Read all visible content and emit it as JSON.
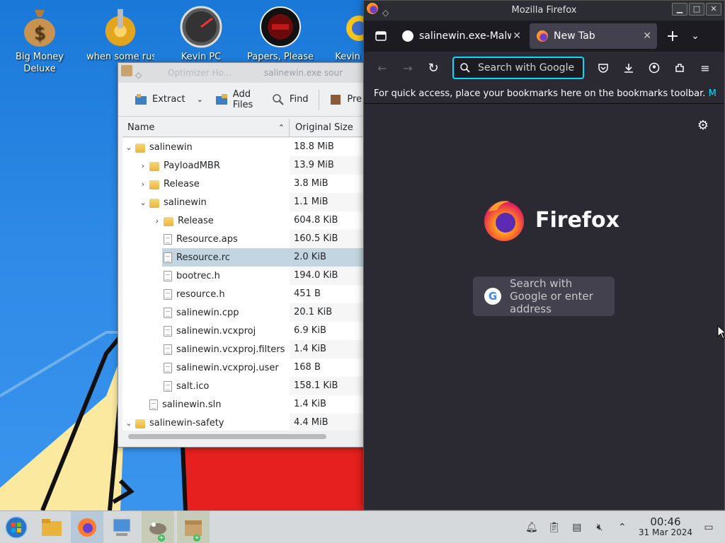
{
  "desktop": {
    "icons": [
      {
        "label": "Big Money Deluxe",
        "icon": "money-bag-icon"
      },
      {
        "label": "when some russian ha",
        "icon": "gear-icon"
      },
      {
        "label": "Kevin PC",
        "icon": "speedometer-icon"
      },
      {
        "label": "Papers, Please",
        "icon": "papers-please-icon"
      },
      {
        "label": "Kevin",
        "icon": "sun-icon"
      }
    ]
  },
  "ark": {
    "title": "salinewin.exe sour",
    "title_ghost": "Optimizer Ho...",
    "toolbar": {
      "extract": "Extract",
      "add_files": "Add Files",
      "find": "Find",
      "preview": "Pre"
    },
    "columns": {
      "name": "Name",
      "size": "Original Size"
    },
    "rows": [
      {
        "name": "salinewin",
        "size": "18.8 MiB",
        "type": "folder",
        "level": 0,
        "expand": "open"
      },
      {
        "name": "PayloadMBR",
        "size": "13.9 MiB",
        "type": "folder",
        "level": 1,
        "expand": "closed"
      },
      {
        "name": "Release",
        "size": "3.8 MiB",
        "type": "folder",
        "level": 1,
        "expand": "closed"
      },
      {
        "name": "salinewin",
        "size": "1.1 MiB",
        "type": "folder",
        "level": 1,
        "expand": "open"
      },
      {
        "name": "Release",
        "size": "604.8 KiB",
        "type": "folder",
        "level": 2,
        "expand": "closed"
      },
      {
        "name": "Resource.aps",
        "size": "160.5 KiB",
        "type": "file",
        "level": 2,
        "expand": ""
      },
      {
        "name": "Resource.rc",
        "size": "2.0 KiB",
        "type": "file",
        "level": 2,
        "expand": "",
        "selected": true
      },
      {
        "name": "bootrec.h",
        "size": "194.0 KiB",
        "type": "file",
        "level": 2,
        "expand": ""
      },
      {
        "name": "resource.h",
        "size": "451 B",
        "type": "file",
        "level": 2,
        "expand": ""
      },
      {
        "name": "salinewin.cpp",
        "size": "20.1 KiB",
        "type": "file",
        "level": 2,
        "expand": ""
      },
      {
        "name": "salinewin.vcxproj",
        "size": "6.9 KiB",
        "type": "file",
        "level": 2,
        "expand": ""
      },
      {
        "name": "salinewin.vcxproj.filters",
        "size": "1.4 KiB",
        "type": "file",
        "level": 2,
        "expand": ""
      },
      {
        "name": "salinewin.vcxproj.user",
        "size": "168 B",
        "type": "file",
        "level": 2,
        "expand": ""
      },
      {
        "name": "salt.ico",
        "size": "158.1 KiB",
        "type": "file",
        "level": 2,
        "expand": ""
      },
      {
        "name": "salinewin.sln",
        "size": "1.4 KiB",
        "type": "file",
        "level": 1,
        "expand": ""
      },
      {
        "name": "salinewin-safety",
        "size": "4.4 MiB",
        "type": "folder",
        "level": 0,
        "expand": "open"
      }
    ]
  },
  "firefox": {
    "window_title": "Mozilla Firefox",
    "tabs": [
      {
        "label": "salinewin.exe-Malw",
        "icon": "github-icon",
        "active": false
      },
      {
        "label": "New Tab",
        "icon": "firefox-icon",
        "active": true
      }
    ],
    "url_placeholder": "Search with Google",
    "bookmarks_message": "For quick access, place your bookmarks here on the bookmarks toolbar.",
    "bookmarks_link": "M",
    "brand": "Firefox",
    "home_search": "Search with Google or enter address"
  },
  "taskbar": {
    "apps": [
      "start-icon",
      "file-manager-icon",
      "firefox-icon",
      "system-info-icon",
      "gimp-icon",
      "archive-icon"
    ],
    "clock": {
      "time": "00:46",
      "date": "31 Mar 2024"
    }
  }
}
